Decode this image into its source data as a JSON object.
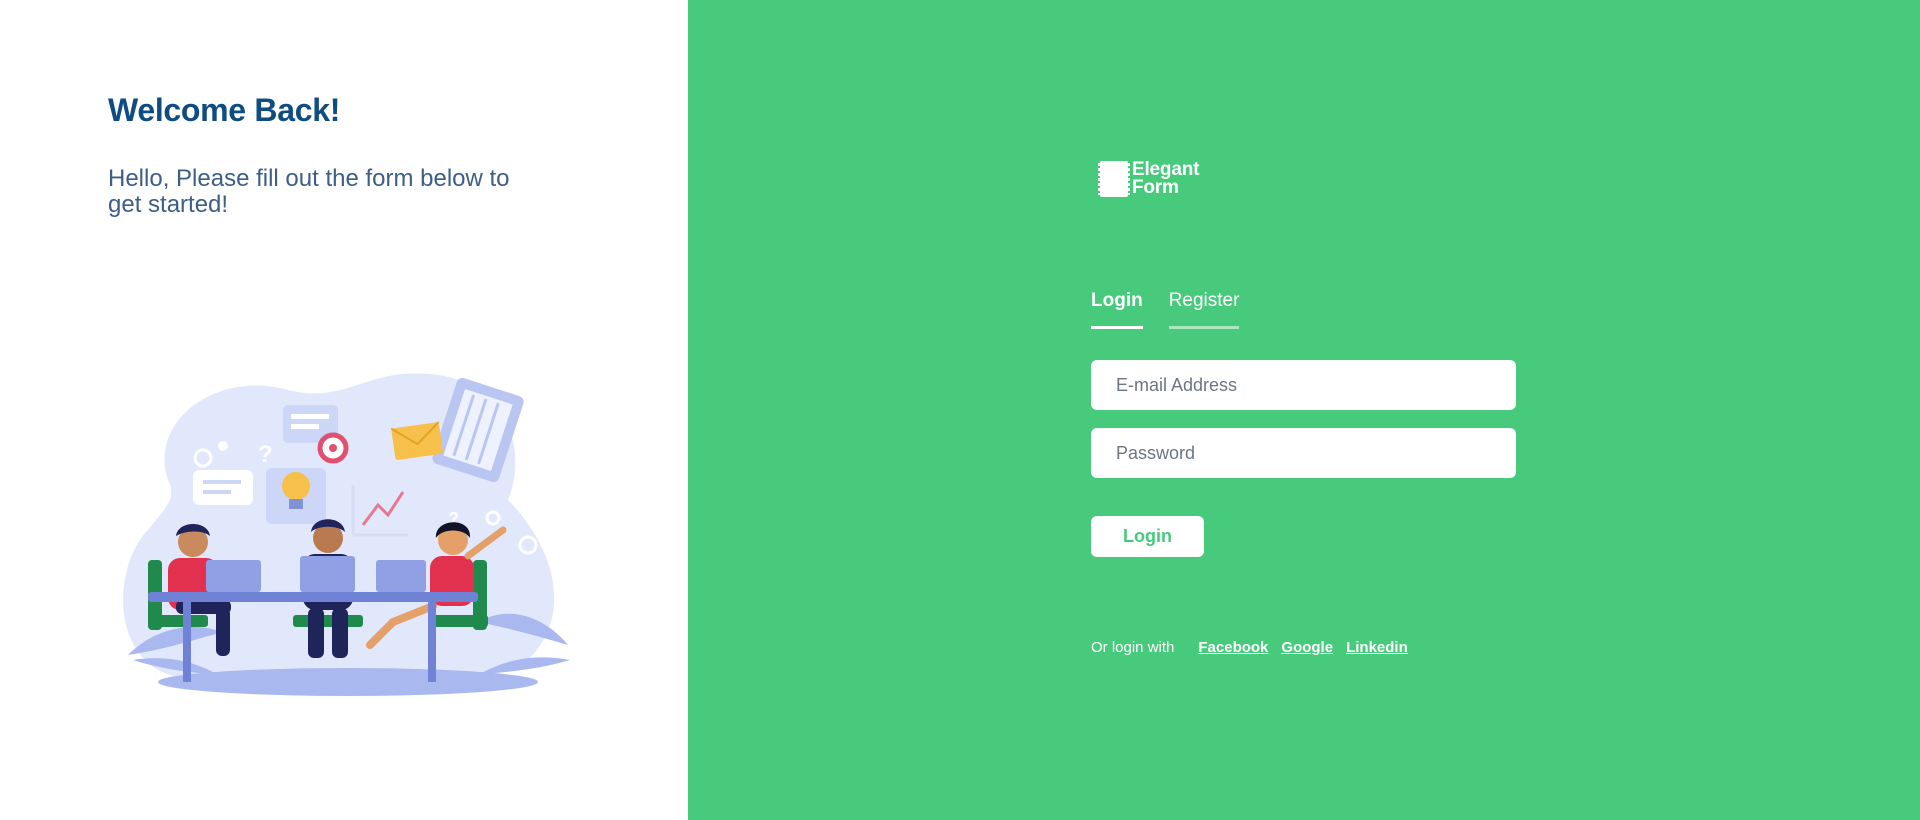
{
  "colors": {
    "brand_green": "#48ca7c",
    "heading_blue": "#0f4c81",
    "subtitle_blue": "#3d5f86"
  },
  "left": {
    "welcome": "Welcome Back!",
    "subtitle": "Hello, Please fill out the form below to get started!",
    "illustration_icon": "team-meeting-illustration"
  },
  "right": {
    "logo": {
      "line1": "Elegant",
      "line2": "Form",
      "icon": "stamp-icon"
    },
    "tabs": {
      "login": "Login",
      "register": "Register"
    },
    "form": {
      "email_placeholder": "E-mail Address",
      "password_placeholder": "Password",
      "email_value": "",
      "password_value": "",
      "submit_label": "Login"
    },
    "social": {
      "lead": "Or login with",
      "links": [
        "Facebook",
        "Google",
        "Linkedin"
      ]
    }
  }
}
